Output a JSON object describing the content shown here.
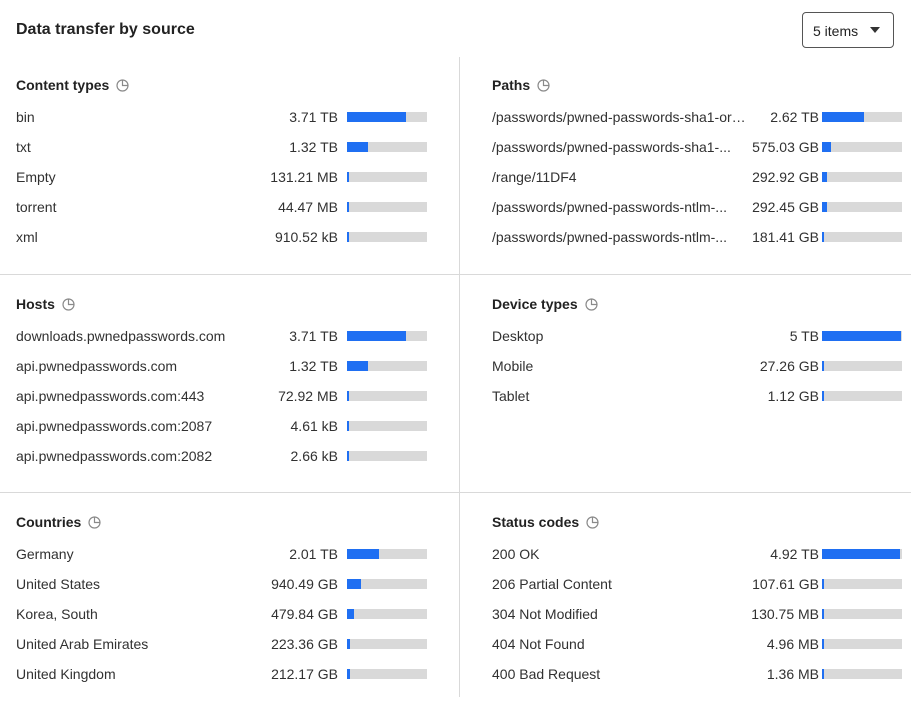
{
  "header": {
    "title": "Data transfer by source",
    "select_value": "5 items"
  },
  "colors": {
    "bar": "#1f6ff2",
    "track": "#d9d9d9"
  },
  "cards": [
    {
      "title": "Content types",
      "rows": [
        {
          "label": "bin",
          "value": "3.71 TB",
          "fraction": 0.74
        },
        {
          "label": "txt",
          "value": "1.32 TB",
          "fraction": 0.26
        },
        {
          "label": "Empty",
          "value": "131.21 MB",
          "fraction": 0.0
        },
        {
          "label": "torrent",
          "value": "44.47 MB",
          "fraction": 0.0
        },
        {
          "label": "xml",
          "value": "910.52 kB",
          "fraction": 0.0
        }
      ]
    },
    {
      "title": "Paths",
      "rows": [
        {
          "label": "/passwords/pwned-passwords-sha1-ord...",
          "value": "2.62 TB",
          "fraction": 0.52
        },
        {
          "label": "/passwords/pwned-passwords-sha1-...",
          "value": "575.03 GB",
          "fraction": 0.11
        },
        {
          "label": "/range/11DF4",
          "value": "292.92 GB",
          "fraction": 0.06
        },
        {
          "label": "/passwords/pwned-passwords-ntlm-...",
          "value": "292.45 GB",
          "fraction": 0.06
        },
        {
          "label": "/passwords/pwned-passwords-ntlm-...",
          "value": "181.41 GB",
          "fraction": 0.03
        }
      ]
    },
    {
      "title": "Hosts",
      "rows": [
        {
          "label": "downloads.pwnedpasswords.com",
          "value": "3.71 TB",
          "fraction": 0.74
        },
        {
          "label": "api.pwnedpasswords.com",
          "value": "1.32 TB",
          "fraction": 0.26
        },
        {
          "label": "api.pwnedpasswords.com:443",
          "value": "72.92 MB",
          "fraction": 0.0
        },
        {
          "label": "api.pwnedpasswords.com:2087",
          "value": "4.61 kB",
          "fraction": 0.0
        },
        {
          "label": "api.pwnedpasswords.com:2082",
          "value": "2.66 kB",
          "fraction": 0.0
        }
      ]
    },
    {
      "title": "Device types",
      "rows": [
        {
          "label": "Desktop",
          "value": "5 TB",
          "fraction": 0.99
        },
        {
          "label": "Mobile",
          "value": "27.26 GB",
          "fraction": 0.01
        },
        {
          "label": "Tablet",
          "value": "1.12 GB",
          "fraction": 0.0
        }
      ]
    },
    {
      "title": "Countries",
      "rows": [
        {
          "label": "Germany",
          "value": "2.01 TB",
          "fraction": 0.4
        },
        {
          "label": "United States",
          "value": "940.49 GB",
          "fraction": 0.18
        },
        {
          "label": "Korea, South",
          "value": "479.84 GB",
          "fraction": 0.09
        },
        {
          "label": "United Arab Emirates",
          "value": "223.36 GB",
          "fraction": 0.04
        },
        {
          "label": "United Kingdom",
          "value": "212.17 GB",
          "fraction": 0.04
        }
      ]
    },
    {
      "title": "Status codes",
      "rows": [
        {
          "label": "200 OK",
          "value": "4.92 TB",
          "fraction": 0.98
        },
        {
          "label": "206 Partial Content",
          "value": "107.61 GB",
          "fraction": 0.02
        },
        {
          "label": "304 Not Modified",
          "value": "130.75 MB",
          "fraction": 0.0
        },
        {
          "label": "404 Not Found",
          "value": "4.96 MB",
          "fraction": 0.0
        },
        {
          "label": "400 Bad Request",
          "value": "1.36 MB",
          "fraction": 0.0
        }
      ]
    }
  ]
}
